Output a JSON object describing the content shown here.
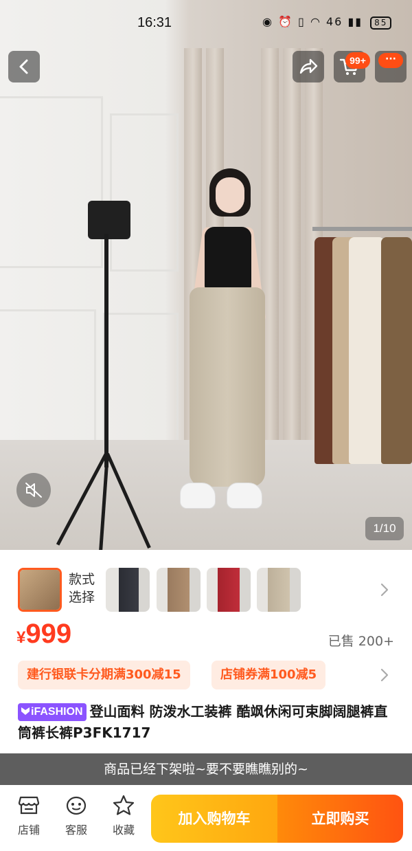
{
  "status_bar": {
    "time": "16:31",
    "icons": "◉ ⏰ ▯ ◠ 46 ▮▮",
    "battery": "85"
  },
  "header": {
    "back_icon": "chevron-left-icon",
    "share_icon": "share-icon",
    "cart_icon": "cart-icon",
    "cart_badge": "99+",
    "more_label": "···"
  },
  "media": {
    "page_indicator": "1/10",
    "mute_icon": "speaker-muted-icon"
  },
  "variants": {
    "label_line1": "款式",
    "label_line2": "选择",
    "count_thumbs": 5,
    "colors": [
      "#a58767",
      "#2b2d34",
      "#9a7b5f",
      "#a5232d",
      "#bdb09a"
    ]
  },
  "price": {
    "currency": "¥",
    "amount": "999",
    "sold": "已售 200+",
    "color": "#ff3b1f"
  },
  "coupons": [
    {
      "text": "建行银联卡分期满300减15"
    },
    {
      "text": "店铺券满100减5"
    }
  ],
  "title": {
    "brand": "iFASHION",
    "text": "登山面料 防泼水工装裤 酷飒休闲可束脚阔腿裤直筒裤长裤P3FK1717"
  },
  "notice": "商品已经下架啦~要不要瞧瞧别的~",
  "bottom_bar": {
    "store": "店铺",
    "service": "客服",
    "favorite": "收藏",
    "add_to_cart": "加入购物车",
    "buy_now": "立即购买"
  }
}
